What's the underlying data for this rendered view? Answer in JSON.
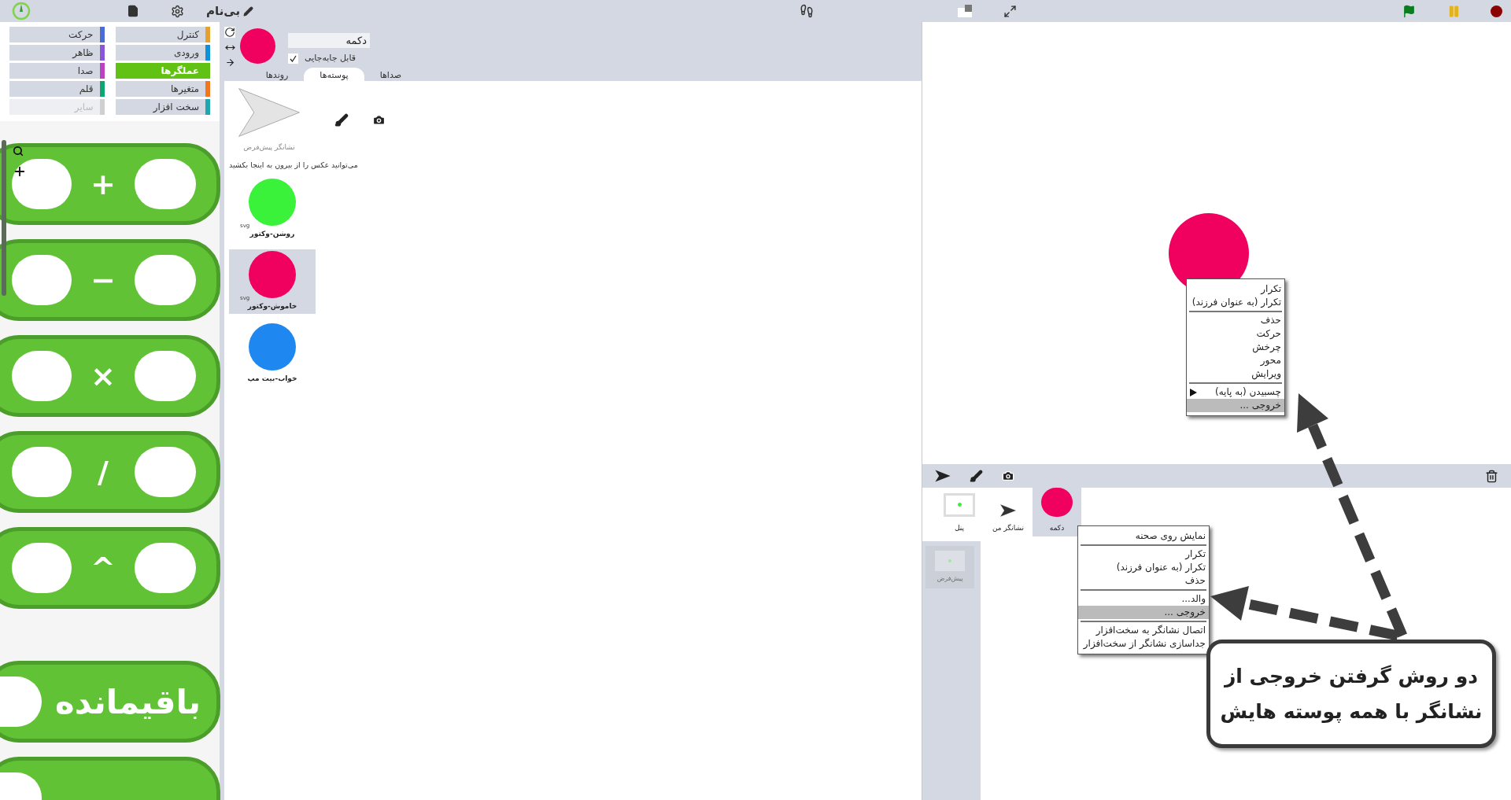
{
  "top_bar": {
    "project_title": "بی‌نام"
  },
  "categories": [
    {
      "label": "کنترل",
      "color": "#e6a030",
      "selected": false,
      "disabled": false
    },
    {
      "label": "حرکت",
      "color": "#4a6cd4",
      "selected": false,
      "disabled": false
    },
    {
      "label": "ورودی",
      "color": "#0d91d8",
      "selected": false,
      "disabled": false
    },
    {
      "label": "ظاهر",
      "color": "#8a55d7",
      "selected": false,
      "disabled": false
    },
    {
      "label": "عملگرها",
      "color": "#62c213",
      "selected": true,
      "disabled": false
    },
    {
      "label": "صدا",
      "color": "#bb42c3",
      "selected": false,
      "disabled": false
    },
    {
      "label": "متغیرها",
      "color": "#f3761d",
      "selected": false,
      "disabled": false
    },
    {
      "label": "قلم",
      "color": "#0fa573",
      "selected": false,
      "disabled": false
    },
    {
      "label": "سخت افزار",
      "color": "#1ea6b1",
      "selected": false,
      "disabled": false
    },
    {
      "label": "سایر",
      "color": "#d0d0d0",
      "selected": false,
      "disabled": true
    }
  ],
  "blocks": [
    {
      "kind": "binary",
      "label": "+"
    },
    {
      "kind": "binary",
      "label": "−"
    },
    {
      "kind": "binary",
      "label": "×"
    },
    {
      "kind": "binary",
      "label": "/"
    },
    {
      "kind": "binary",
      "label": "^"
    },
    {
      "kind": "unary",
      "label": "باقیمانده"
    },
    {
      "kind": "unary"
    }
  ],
  "sprite": {
    "name": "دکمه",
    "draggable_label": "قابل جابه‌جایی",
    "draggable": true
  },
  "tabs": [
    {
      "label": "صداها",
      "selected": false
    },
    {
      "label": "پوسته‌ها",
      "selected": true
    },
    {
      "label": "روندها",
      "selected": false
    }
  ],
  "default_costume": {
    "label": "نشانگر پیش‌فرض"
  },
  "drop_hint": "می‌توانید عکس را از بیرون به اینجا بکشید",
  "costumes": [
    {
      "name": "روشن-وکتور",
      "color": "#3af23a",
      "format": "svg",
      "selected": false
    },
    {
      "name": "خاموش-وکتور",
      "color": "#f0005f",
      "format": "svg",
      "selected": true
    },
    {
      "name": "خواب-بیت مپ",
      "color": "#1e88f0",
      "selected": false
    }
  ],
  "stage_menu": [
    {
      "kind": "item",
      "label": "تکرار",
      "highlighted": false
    },
    {
      "kind": "item",
      "label": "تکرار  (به عنوان فرزند)",
      "highlighted": false
    },
    {
      "kind": "separator"
    },
    {
      "kind": "item",
      "label": "حذف",
      "highlighted": false
    },
    {
      "kind": "item",
      "label": "حرکت",
      "highlighted": false
    },
    {
      "kind": "item",
      "label": "چرخش",
      "highlighted": false
    },
    {
      "kind": "item",
      "label": "محور",
      "highlighted": false
    },
    {
      "kind": "item",
      "label": "ویرایش",
      "highlighted": false
    },
    {
      "kind": "separator"
    },
    {
      "kind": "submenu",
      "label": "چسبیدن (به پایه)",
      "highlighted": false
    },
    {
      "kind": "item",
      "label": "خروجی ...",
      "highlighted": true
    }
  ],
  "corral": {
    "sprites": [
      {
        "kind": "circle",
        "name": "دکمه",
        "selected": true
      },
      {
        "kind": "turtle",
        "name": "نشانگر من",
        "selected": false
      },
      {
        "kind": "stage",
        "name": "پنل",
        "selected": false
      }
    ],
    "scenes": [
      {
        "name": "پیش‌فرض"
      }
    ]
  },
  "corral_menu": [
    {
      "kind": "item",
      "label": "نمایش روی صحنه",
      "highlighted": false
    },
    {
      "kind": "separator"
    },
    {
      "kind": "item",
      "label": "تکرار",
      "highlighted": false
    },
    {
      "kind": "item",
      "label": "تکرار  (به عنوان فرزند)",
      "highlighted": false
    },
    {
      "kind": "item",
      "label": "حذف",
      "highlighted": false
    },
    {
      "kind": "separator"
    },
    {
      "kind": "item",
      "label": "والد...",
      "highlighted": false
    },
    {
      "kind": "item",
      "label": "خروجی ...",
      "highlighted": true
    },
    {
      "kind": "separator"
    },
    {
      "kind": "item",
      "label": "اتصال نشانگر به سخت‌افزار",
      "highlighted": false
    },
    {
      "kind": "item",
      "label": "جداسازی نشانگر از سخت‌افزار",
      "highlighted": false
    }
  ],
  "callout": {
    "lines": [
      "دو روش گرفتن خروجی از",
      "نشانگر با همه پوسته هایش"
    ]
  }
}
